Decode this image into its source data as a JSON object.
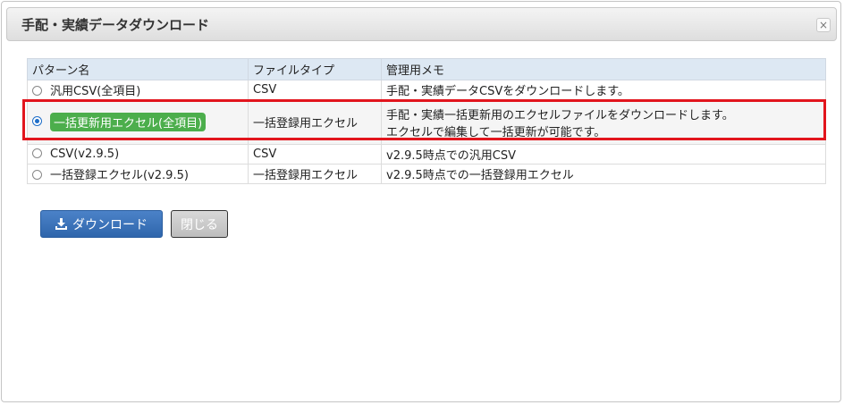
{
  "dialog": {
    "title": "手配・実績データダウンロード",
    "close_glyph": "×"
  },
  "table": {
    "headers": [
      "パターン名",
      "ファイルタイプ",
      "管理用メモ"
    ],
    "rows": [
      {
        "name": "汎用CSV(全項目)",
        "type": "CSV",
        "memo_lines": [
          "手配・実績データCSVをダウンロードします。"
        ],
        "selected": false
      },
      {
        "name": "一括更新用エクセル(全項目)",
        "type": "一括登録用エクセル",
        "memo_lines": [
          "手配・実績一括更新用のエクセルファイルをダウンロードします。",
          "エクセルで編集して一括更新が可能です。"
        ],
        "selected": true
      },
      {
        "name": "CSV(v2.9.5)",
        "type": "CSV",
        "memo_lines": [
          "v2.9.5時点での汎用CSV"
        ],
        "selected": false
      },
      {
        "name": "一括登録エクセル(v2.9.5)",
        "type": "一括登録用エクセル",
        "memo_lines": [
          "v2.9.5時点での一括登録用エクセル"
        ],
        "selected": false
      }
    ]
  },
  "buttons": {
    "download_label": "ダウンロード",
    "download_icon": "download-icon",
    "close_label": "閉じる"
  },
  "colors": {
    "header_bg": "#dde8f3",
    "badge_green": "#4cae4c",
    "highlight_red": "#e2151d",
    "primary_blue": "#3a72b9"
  }
}
